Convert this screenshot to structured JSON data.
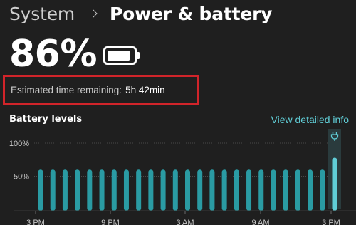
{
  "breadcrumb": {
    "parent": "System",
    "current": "Power & battery"
  },
  "battery": {
    "percent": "86%",
    "level": 0.86,
    "estimate_label": "Estimated time remaining:",
    "estimate_value": "5h 42min"
  },
  "levels": {
    "title": "Battery levels",
    "detail_link": "View detailed info"
  },
  "colors": {
    "accent": "#60cdd6",
    "bar": "#2a9ba3",
    "highlight_box": "#d1242a"
  },
  "icons": {
    "battery": "battery-icon",
    "charging": "plug-icon"
  },
  "chart_data": {
    "type": "bar",
    "y_ticks": [
      "100%",
      "50%"
    ],
    "ylim": [
      0,
      100
    ],
    "x_ticks": [
      "3 PM",
      "9 PM",
      "3 AM",
      "9 AM",
      "3 PM"
    ],
    "grid": true,
    "values": [
      60,
      60,
      60,
      60,
      60,
      60,
      60,
      60,
      60,
      60,
      60,
      60,
      60,
      60,
      60,
      60,
      60,
      60,
      60,
      60,
      60,
      60,
      60,
      60,
      78
    ],
    "charging_indices": [
      24
    ]
  }
}
